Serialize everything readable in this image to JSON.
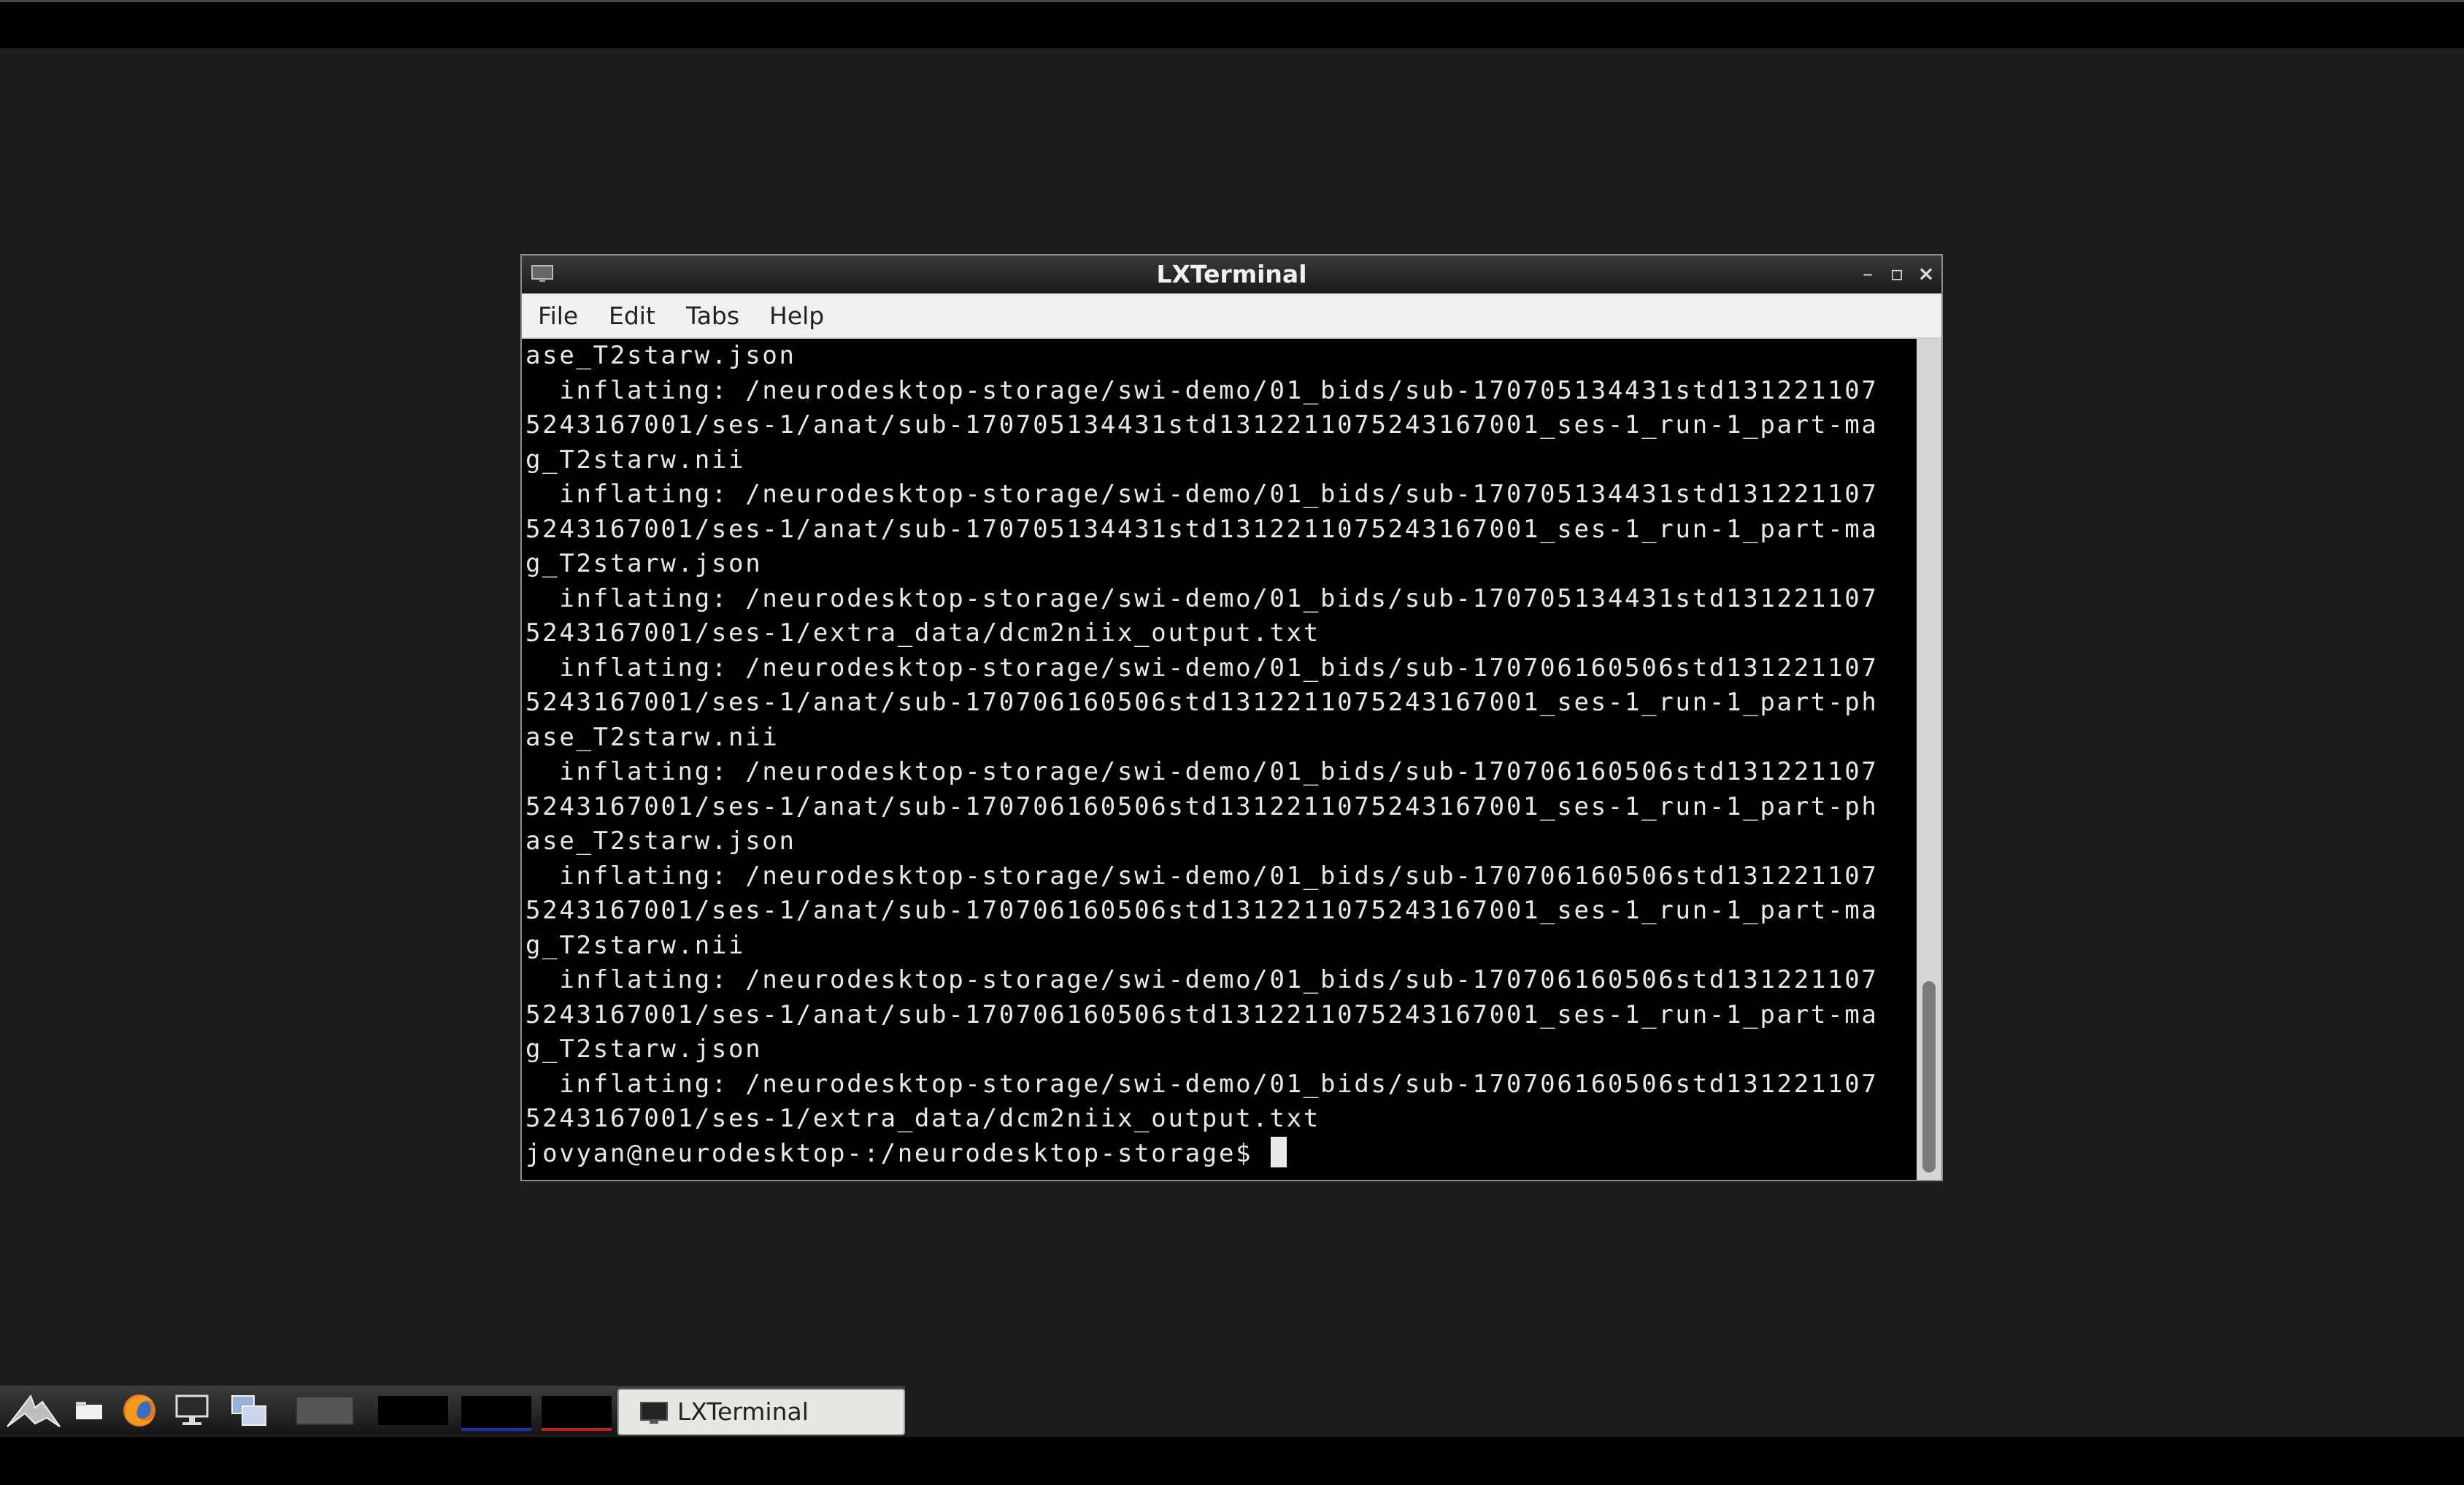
{
  "window": {
    "title": "LXTerminal",
    "menu": [
      "File",
      "Edit",
      "Tabs",
      "Help"
    ]
  },
  "terminal": {
    "lines": [
      "ase_T2starw.json",
      "  inflating: /neurodesktop-storage/swi-demo/01_bids/sub-170705134431std131221107",
      "5243167001/ses-1/anat/sub-170705134431std1312211075243167001_ses-1_run-1_part-ma",
      "g_T2starw.nii",
      "  inflating: /neurodesktop-storage/swi-demo/01_bids/sub-170705134431std131221107",
      "5243167001/ses-1/anat/sub-170705134431std1312211075243167001_ses-1_run-1_part-ma",
      "g_T2starw.json",
      "  inflating: /neurodesktop-storage/swi-demo/01_bids/sub-170705134431std131221107",
      "5243167001/ses-1/extra_data/dcm2niix_output.txt",
      "  inflating: /neurodesktop-storage/swi-demo/01_bids/sub-170706160506std131221107",
      "5243167001/ses-1/anat/sub-170706160506std1312211075243167001_ses-1_run-1_part-ph",
      "ase_T2starw.nii",
      "  inflating: /neurodesktop-storage/swi-demo/01_bids/sub-170706160506std131221107",
      "5243167001/ses-1/anat/sub-170706160506std1312211075243167001_ses-1_run-1_part-ph",
      "ase_T2starw.json",
      "  inflating: /neurodesktop-storage/swi-demo/01_bids/sub-170706160506std131221107",
      "5243167001/ses-1/anat/sub-170706160506std1312211075243167001_ses-1_run-1_part-ma",
      "g_T2starw.nii",
      "  inflating: /neurodesktop-storage/swi-demo/01_bids/sub-170706160506std131221107",
      "5243167001/ses-1/anat/sub-170706160506std1312211075243167001_ses-1_run-1_part-ma",
      "g_T2starw.json",
      "  inflating: /neurodesktop-storage/swi-demo/01_bids/sub-170706160506std131221107",
      "5243167001/ses-1/extra_data/dcm2niix_output.txt"
    ],
    "prompt": "jovyan@neurodesktop-:/neurodesktop-storage$ "
  },
  "taskbar": {
    "task_label": "LXTerminal"
  },
  "colors": {
    "workspace_blue": "#1b2fa8",
    "workspace_red": "#c0201c",
    "terminal_bg": "#000000",
    "terminal_fg": "#e8e8e8"
  },
  "icons": [
    "menu-icon",
    "folder-icon",
    "firefox-icon",
    "desktop-icon",
    "windows-icon",
    "terminal-icon"
  ]
}
